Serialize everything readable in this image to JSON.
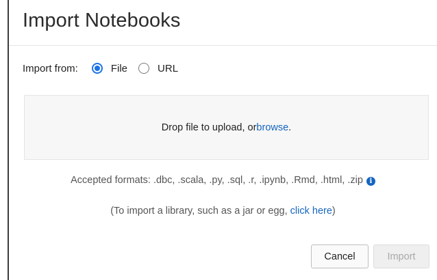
{
  "dialog": {
    "title": "Import Notebooks",
    "import_from": {
      "label": "Import from:",
      "options": [
        {
          "label": "File",
          "selected": true
        },
        {
          "label": "URL",
          "selected": false
        }
      ]
    },
    "dropzone": {
      "text_before": "Drop file to upload, or ",
      "link": "browse",
      "text_after": "."
    },
    "accepted_formats": "Accepted formats: .dbc, .scala, .py, .sql, .r, .ipynb, .Rmd, .html, .zip",
    "library_note": {
      "before": "(To import a library, such as a jar or egg, ",
      "link": "click here",
      "after": ")"
    },
    "buttons": {
      "cancel": "Cancel",
      "import": "Import",
      "import_disabled": true
    }
  },
  "colors": {
    "accent": "#1a73e8",
    "link": "#1565c0",
    "dropzone_bg": "#f7f7f7"
  },
  "icons": {
    "info": "info-icon"
  }
}
